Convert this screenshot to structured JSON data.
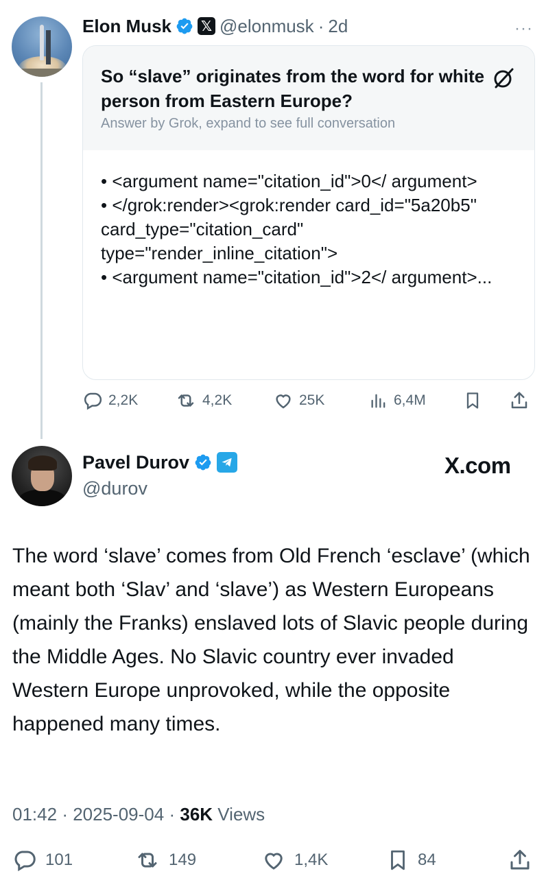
{
  "parent": {
    "author_name": "Elon Musk",
    "handle": "@elonmusk",
    "separator": "·",
    "time_ago": "2d",
    "more_label": "···",
    "grok_card": {
      "question": "So “slave” originates from the word for white person from Eastern Europe?",
      "subtitle": "Answer by Grok, expand to see full conversation",
      "lines": [
        "• <argument name=\"citation_id\">0</ argument>",
        "• </grok:render><grok:render card_id=\"5a20b5\" card_type=\"citation_card\" type=\"render_inline_citation\">",
        "• <argument name=\"citation_id\">2</ argument>..."
      ]
    },
    "actions": {
      "replies": "2,2K",
      "reposts": "4,2K",
      "likes": "25K",
      "views": "6,4M"
    }
  },
  "tweet": {
    "author_name": "Pavel Durov",
    "handle": "@durov",
    "watermark": "X.com",
    "text": "The word ‘slave’ comes from Old French ‘esclave’ (which meant both ‘Slav’ and ‘slave’) as Western Europeans (mainly the Franks) enslaved lots of Slavic people during the Middle Ages. No Slavic country ever invaded Western Europe unprovoked, while the opposite happened many times.",
    "time": "01:42",
    "date": "2025-09-04",
    "meta_separator": "·",
    "views_count": "36K",
    "views_label": "Views",
    "actions": {
      "replies": "101",
      "reposts": "149",
      "likes": "1,4K",
      "bookmarks": "84"
    }
  },
  "colors": {
    "verified": "#1d9bf0",
    "telegram": "#27a7e7",
    "secondary_text": "#536471",
    "primary_text": "#0f1419"
  },
  "icons": [
    "verified-badge-icon",
    "x-affiliate-icon",
    "grok-icon",
    "reply-icon",
    "repost-icon",
    "like-icon",
    "views-icon",
    "bookmark-icon",
    "share-icon",
    "telegram-icon"
  ]
}
